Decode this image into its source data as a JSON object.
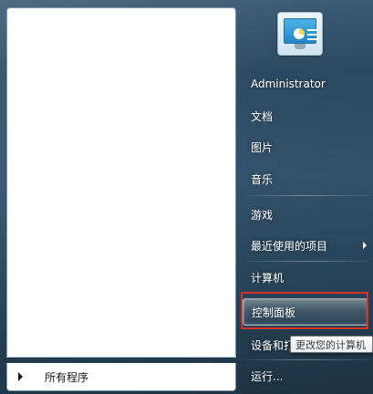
{
  "left_pane": {
    "all_programs_label": "所有程序"
  },
  "user": {
    "tile_icon": "control-panel-monitor-icon"
  },
  "right_pane": {
    "items": [
      {
        "label": "Administrator"
      },
      {
        "label": "文档"
      },
      {
        "label": "图片"
      },
      {
        "label": "音乐"
      },
      {
        "label": "游戏"
      },
      {
        "label": "最近使用的项目"
      },
      {
        "label": "计算机"
      },
      {
        "label": "控制面板"
      },
      {
        "label": "设备和打"
      },
      {
        "label": "运行..."
      }
    ]
  },
  "tooltip": {
    "text": "更改您的计算机"
  },
  "colors": {
    "highlight_box": "#d9302a",
    "menu_background": "#2d4a62"
  }
}
